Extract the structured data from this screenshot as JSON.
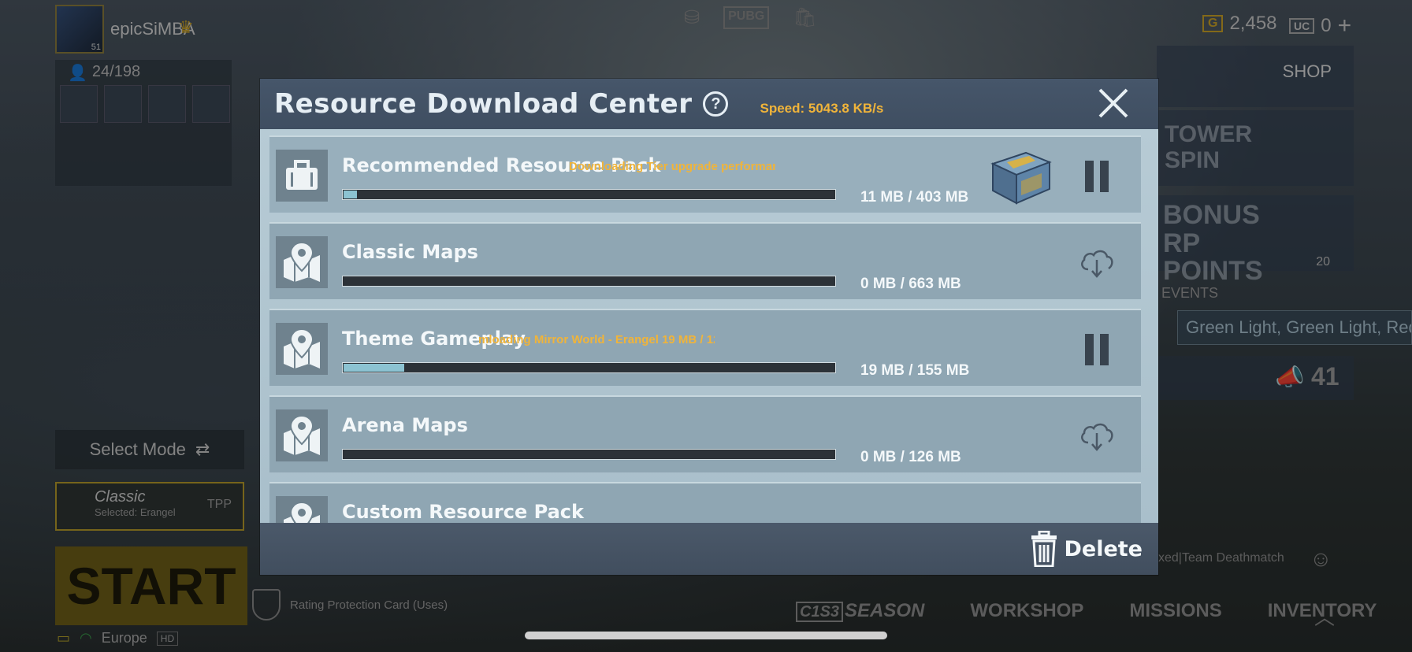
{
  "lobby": {
    "player_name": "epicSiMBA",
    "avatar_level": "51",
    "friends_count": "24/198",
    "select_mode_label": "Select Mode",
    "mode_name": "Classic",
    "mode_sub": "Selected: Erangel",
    "mode_perspective": "TPP",
    "start_label": "START",
    "region": "Europe",
    "quality_tag": "HD",
    "rating_card_label": "Rating Protection Card (Uses)",
    "currency_bp": "2,458",
    "currency_uc": "0",
    "bp_badge": "G",
    "uc_badge": "UC",
    "shop_label": "SHOP",
    "events_label": "EVENTS",
    "events_count": "20",
    "event_banner": "Green Light, Green Light, Red Light",
    "mode_count": "41",
    "deathmatch_label": "xed|Team Deathmatch",
    "bottom_tabs": [
      "SEASON",
      "WORKSHOP",
      "MISSIONS",
      "INVENTORY"
    ],
    "season_tag": "C1S3",
    "tower_spin_label": "TOWER SPIN",
    "bonus_label": "BONUS RP POINTS"
  },
  "dialog": {
    "title": "Resource Download Center",
    "speed": "Speed: 5043.8 KB/s",
    "delete_label": "Delete",
    "rows": [
      {
        "name": "Recommended Resource Pack",
        "status": "Downloading Tier upgrade performance 7 M",
        "size": "11 MB / 403 MB",
        "progress": 0.027,
        "action": "pause",
        "icon": "briefcase-icon"
      },
      {
        "name": "Classic Maps",
        "status": "",
        "size": "0 MB / 663 MB",
        "progress": 0,
        "action": "download",
        "icon": "map-pin-icon"
      },
      {
        "name": "Theme Gameplay",
        "status": "mloading Mirror World - Erangel 19 MB / 12",
        "size": "19 MB / 155 MB",
        "progress": 0.123,
        "action": "pause",
        "icon": "map-pin-icon"
      },
      {
        "name": "Arena Maps",
        "status": "",
        "size": "0 MB / 126 MB",
        "progress": 0,
        "action": "download",
        "icon": "map-pin-icon"
      },
      {
        "name": "Custom Resource Pack",
        "status": "",
        "size": "",
        "progress": 0,
        "action": "download",
        "icon": "map-pin-icon"
      }
    ]
  },
  "colors": {
    "accent_orange": "#f0b43a",
    "progress_fill": "#8cc3d2",
    "header_bg": "#46566a"
  }
}
